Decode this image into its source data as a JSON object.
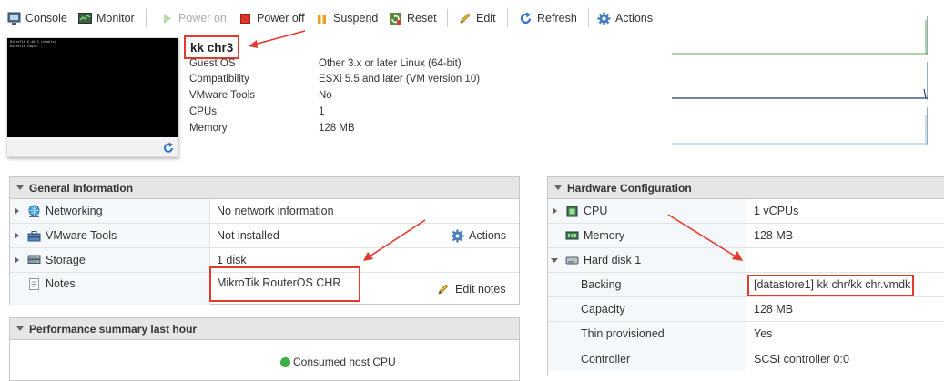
{
  "toolbar": {
    "console": "Console",
    "monitor": "Monitor",
    "power_on": "Power on",
    "power_off": "Power off",
    "suspend": "Suspend",
    "reset": "Reset",
    "edit": "Edit",
    "refresh": "Refresh",
    "actions": "Actions"
  },
  "summary": {
    "vm_name": "kk chr3",
    "properties": [
      {
        "label": "Guest OS",
        "value": "Other 3.x or later Linux (64-bit)"
      },
      {
        "label": "Compatibility",
        "value": "ESXi 5.5 and later (VM version 10)"
      },
      {
        "label": "VMware Tools",
        "value": "No"
      },
      {
        "label": "CPUs",
        "value": "1"
      },
      {
        "label": "Memory",
        "value": "128 MB"
      }
    ],
    "console_text": "MikroTik 6.40.3 (stable)\nMikroTik Login: _"
  },
  "general": {
    "title": "General Information",
    "rows": [
      {
        "label": "Networking",
        "value": "No network information"
      },
      {
        "label": "VMware Tools",
        "value": "Not installed",
        "action": "Actions"
      },
      {
        "label": "Storage",
        "value": "1 disk"
      },
      {
        "label": "Notes",
        "value": "MikroTik RouterOS CHR",
        "action": "Edit notes"
      }
    ]
  },
  "performance": {
    "title": "Performance summary last hour",
    "legend": "Consumed host CPU"
  },
  "hardware": {
    "title": "Hardware Configuration",
    "rows": [
      {
        "label": "CPU",
        "value": "1 vCPUs"
      },
      {
        "label": "Memory",
        "value": "128 MB"
      },
      {
        "label": "Hard disk 1",
        "value": ""
      },
      {
        "label": "Backing",
        "value": "[datastore1] kk chr/kk chr.vmdk"
      },
      {
        "label": "Capacity",
        "value": "128 MB"
      },
      {
        "label": "Thin provisioned",
        "value": "Yes"
      },
      {
        "label": "Controller",
        "value": "SCSI controller 0:0"
      }
    ]
  },
  "colors": {
    "accent_red": "#e23b2e",
    "link_blue": "#1a5fa8",
    "header_gray": "#e6e6e6",
    "green": "#3cb043"
  }
}
